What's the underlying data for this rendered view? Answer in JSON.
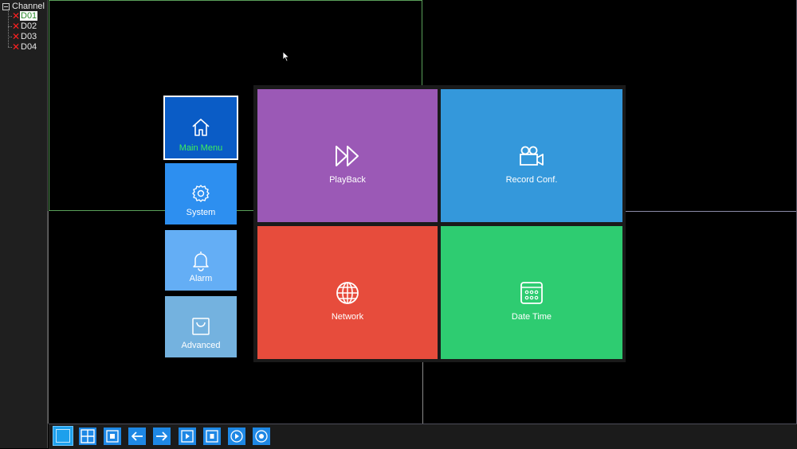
{
  "channel_panel": {
    "title": "Channel",
    "channels": [
      {
        "label": "D01",
        "selected": true
      },
      {
        "label": "D02",
        "selected": false
      },
      {
        "label": "D03",
        "selected": false
      },
      {
        "label": "D04",
        "selected": false
      }
    ]
  },
  "side_menu": [
    {
      "label": "Main Menu",
      "icon": "home-icon",
      "color": "#0a5cc6",
      "active": true
    },
    {
      "label": "System",
      "icon": "gear-icon",
      "color": "#2d8ff0"
    },
    {
      "label": "Alarm",
      "icon": "bell-icon",
      "color": "#64aef5"
    },
    {
      "label": "Advanced",
      "icon": "bag-icon",
      "color": "#74b2df"
    }
  ],
  "main_tiles": [
    {
      "label": "PlayBack",
      "icon": "fast-forward-icon",
      "color": "#9b59b6"
    },
    {
      "label": "Record Conf.",
      "icon": "video-camera-icon",
      "color": "#3498db"
    },
    {
      "label": "Network",
      "icon": "globe-icon",
      "color": "#e74c3c"
    },
    {
      "label": "Date Time",
      "icon": "calendar-icon",
      "color": "#2ecc71"
    }
  ],
  "toolbar": [
    {
      "icon": "single-view-icon"
    },
    {
      "icon": "quad-view-icon"
    },
    {
      "icon": "fullscreen-icon"
    },
    {
      "icon": "arrow-left-icon"
    },
    {
      "icon": "arrow-right-icon"
    },
    {
      "icon": "play-icon"
    },
    {
      "icon": "record-icon"
    },
    {
      "icon": "playback-icon"
    },
    {
      "icon": "snapshot-icon"
    }
  ]
}
